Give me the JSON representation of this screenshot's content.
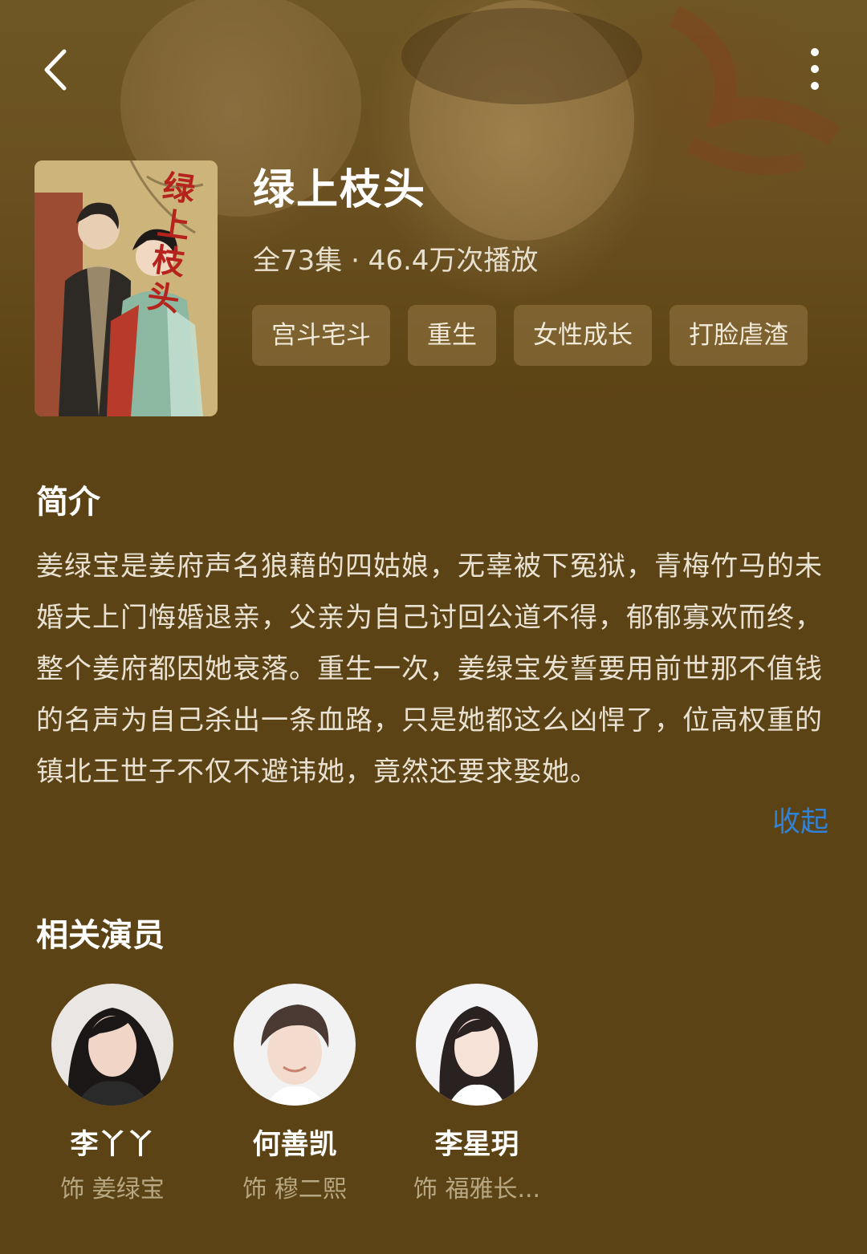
{
  "nav": {
    "back_icon": "chevron-left-icon",
    "more_icon": "more-vertical-icon"
  },
  "show": {
    "title": "绿上枝头",
    "poster_title": "绿上枝头",
    "meta": "全73集 · 46.4万次播放",
    "tags": [
      "宫斗宅斗",
      "重生",
      "女性成长",
      "打脸虐渣"
    ]
  },
  "synopsis": {
    "heading": "简介",
    "text": "姜绿宝是姜府声名狼藉的四姑娘，无辜被下冤狱，青梅竹马的未婚夫上门悔婚退亲，父亲为自己讨回公道不得，郁郁寡欢而终，整个姜府都因她衰落。重生一次，姜绿宝发誓要用前世那不值钱的名声为自己杀出一条血路，只是她都这么凶悍了，位高权重的镇北王世子不仅不避讳她，竟然还要求娶她。",
    "collapse_label": "收起"
  },
  "cast": {
    "heading": "相关演员",
    "actors": [
      {
        "name": "李丫丫",
        "role": "饰 姜绿宝"
      },
      {
        "name": "何善凯",
        "role": "饰 穆二熙"
      },
      {
        "name": "李星玥",
        "role": "饰 福雅长..."
      }
    ]
  },
  "colors": {
    "background": "#5c4315",
    "accent_link": "#2f82d8",
    "tag_bg": "#8f7646"
  }
}
